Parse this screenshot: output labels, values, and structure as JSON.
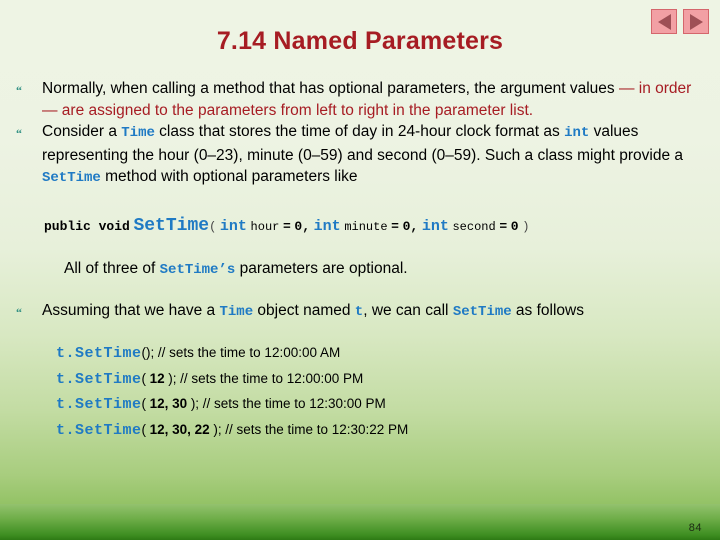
{
  "slide": {
    "title": "7.14 Named Parameters",
    "page_number": "84",
    "accent_red": "#a61c23",
    "code_blue": "#1f7ac4",
    "bullet_teal": "#2f8f82"
  },
  "nav": {
    "prev_icon": "triangle-left-icon",
    "next_icon": "triangle-right-icon"
  },
  "bullets": {
    "glyph": "“",
    "b1": {
      "seg1": "Normally, when calling a method that has optional parameters, the argument values ",
      "seg2": "— in order — are assigned to the parameters from left to right in the parameter list."
    },
    "b2": {
      "seg1": "Consider a ",
      "code1": "Time",
      "seg2": " class that stores the time of day in 24-hour clock format as ",
      "code2": "int",
      "seg3": " values representing the hour (0–23), minute (0–59) and second (0–59). Such a class might provide a ",
      "code3": "SetTime",
      "seg4": " method with optional parameters like"
    },
    "b3": {
      "seg1": "Assuming that we have a ",
      "code1": "Time",
      "seg2": " object named ",
      "code2": "t",
      "seg3": ", we can call ",
      "code3": "SetTime",
      "seg4": " as follows"
    }
  },
  "signature": {
    "keywords": "public void",
    "method": "SetTime",
    "open_paren": "(",
    "type1": "int",
    "param1": "hour",
    "eq1": "=",
    "default1": "0",
    "comma1": ",",
    "type2": "int",
    "param2": "minute",
    "eq2": "=",
    "default2": "0",
    "comma2": ",",
    "type3": "int",
    "param3": "second",
    "eq3": "=",
    "default3": "0",
    "close_paren": ")"
  },
  "optional_note": {
    "seg1": "All of three of ",
    "code": "SetTime’s",
    "seg2": " parameters are optional."
  },
  "examples": [
    {
      "call": "t.SetTime",
      "open": "(",
      "args": "",
      "close": ");",
      "comment": "// sets the time to 12:00:00 AM"
    },
    {
      "call": "t.SetTime",
      "open": "(",
      "args": "12",
      "close": ");",
      "comment": "// sets the time to 12:00:00 PM"
    },
    {
      "call": "t.SetTime",
      "open": "(",
      "args": "12, 30",
      "close": ");",
      "comment": "// sets the time to 12:30:00 PM"
    },
    {
      "call": "t.SetTime",
      "open": "(",
      "args": "12, 30, 22",
      "close": ");",
      "comment": "// sets the time to 12:30:22 PM"
    }
  ]
}
